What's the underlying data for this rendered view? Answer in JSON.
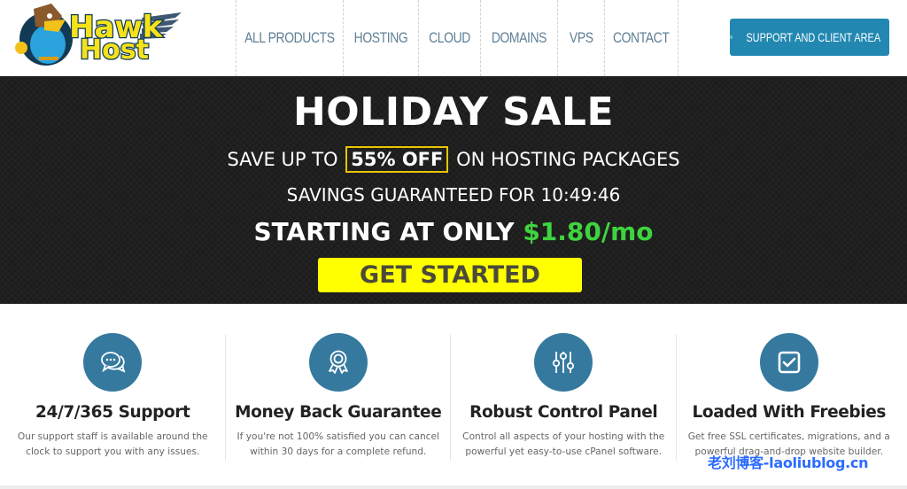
{
  "header": {
    "logo_text_top": "Hawk",
    "logo_text_bottom": "Host",
    "nav": [
      {
        "label": "ALL PRODUCTS"
      },
      {
        "label": "HOSTING"
      },
      {
        "label": "CLOUD"
      },
      {
        "label": "DOMAINS"
      },
      {
        "label": "VPS"
      },
      {
        "label": "CONTACT"
      }
    ],
    "support_button": {
      "label": "SUPPORT AND CLIENT AREA",
      "icon": "life-ring-icon"
    }
  },
  "banner": {
    "title": "HOLIDAY SALE",
    "save_prefix": "SAVE UP TO",
    "save_highlight": "55% OFF",
    "save_suffix": "ON HOSTING PACKAGES",
    "timer_label": "SAVINGS GUARANTEED FOR",
    "timer_value": "10:49:46",
    "starting_label": "STARTING AT ONLY",
    "price": "$1.80/mo",
    "cta_label": "GET STARTED"
  },
  "features": [
    {
      "icon": "chat-bubbles-icon",
      "title": "24/7/365 Support",
      "description": "Our support staff is available around the clock to support you with any issues."
    },
    {
      "icon": "award-ribbon-icon",
      "title": "Money Back Guarantee",
      "description": "If you're not 100% satisfied you can cancel within 30 days for a complete refund."
    },
    {
      "icon": "sliders-icon",
      "title": "Robust Control Panel",
      "description": "Control all aspects of your hosting with the powerful yet easy-to-use cPanel software."
    },
    {
      "icon": "checkbox-icon",
      "title": "Loaded With Freebies",
      "description": "Get free SSL certificates, migrations, and a powerful drag-and-drop website builder."
    }
  ],
  "colors": {
    "nav_text": "#5f7f95",
    "support_button": "#2288b1",
    "banner_bg": "#1c1c1c",
    "highlight_border": "#e8c500",
    "price": "#3ed43e",
    "cta_bg": "#ffff00",
    "feature_circle": "#35799e"
  },
  "watermark": "老刘博客-laoliublog.cn"
}
